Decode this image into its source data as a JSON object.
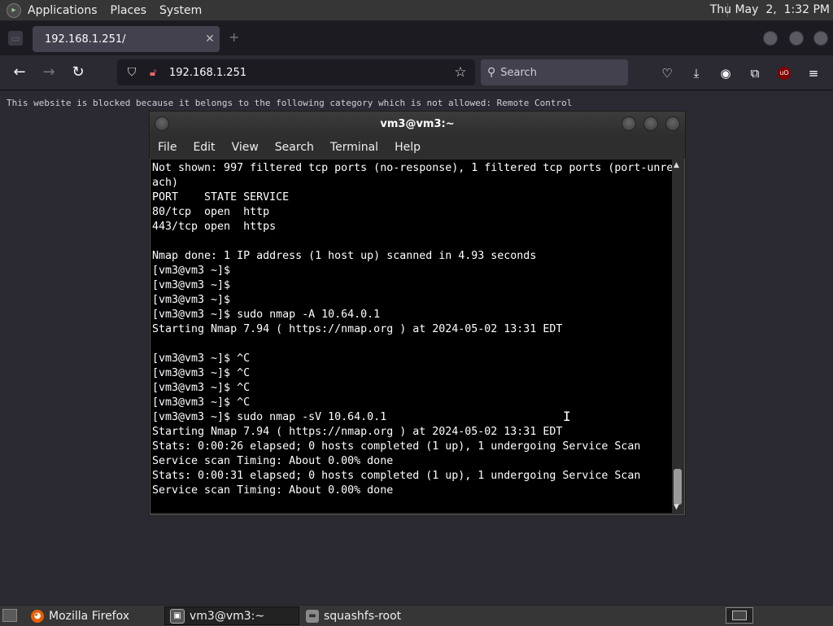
{
  "top_panel": {
    "menus": [
      "Applications",
      "Places",
      "System"
    ],
    "clock": "Thu May  2,  1:32 PM"
  },
  "browser": {
    "tab": {
      "title": "192.168.1.251/",
      "close": "✕"
    },
    "url": "192.168.1.251",
    "search_placeholder": "Search",
    "page_message": "This website is blocked because it belongs to the following category which is not allowed: Remote Control"
  },
  "terminal": {
    "title": "vm3@vm3:~",
    "menus": [
      "File",
      "Edit",
      "View",
      "Search",
      "Terminal",
      "Help"
    ],
    "lines": [
      "Not shown: 997 filtered tcp ports (no-response), 1 filtered tcp ports (port-unre",
      "ach)",
      "PORT    STATE SERVICE",
      "80/tcp  open  http",
      "443/tcp open  https",
      "",
      "Nmap done: 1 IP address (1 host up) scanned in 4.93 seconds",
      "[vm3@vm3 ~]$",
      "[vm3@vm3 ~]$",
      "[vm3@vm3 ~]$",
      "[vm3@vm3 ~]$ sudo nmap -A 10.64.0.1",
      "Starting Nmap 7.94 ( https://nmap.org ) at 2024-05-02 13:31 EDT",
      "",
      "[vm3@vm3 ~]$ ^C",
      "[vm3@vm3 ~]$ ^C",
      "[vm3@vm3 ~]$ ^C",
      "[vm3@vm3 ~]$ ^C",
      "[vm3@vm3 ~]$ sudo nmap -sV 10.64.0.1",
      "Starting Nmap 7.94 ( https://nmap.org ) at 2024-05-02 13:31 EDT",
      "Stats: 0:00:26 elapsed; 0 hosts completed (1 up), 1 undergoing Service Scan",
      "Service scan Timing: About 0.00% done",
      "Stats: 0:00:31 elapsed; 0 hosts completed (1 up), 1 undergoing Service Scan",
      "Service scan Timing: About 0.00% done"
    ]
  },
  "taskbar": {
    "items": [
      {
        "label": "Mozilla Firefox",
        "icon": "firefox-icon"
      },
      {
        "label": "vm3@vm3:~",
        "icon": "terminal-icon"
      },
      {
        "label": "squashfs-root",
        "icon": "folder-icon"
      }
    ]
  },
  "colors": {
    "browser_bg": "#2b2a33",
    "terminal_bg": "#000000",
    "panel_bg": "#363636",
    "ublock_red": "#800000"
  }
}
